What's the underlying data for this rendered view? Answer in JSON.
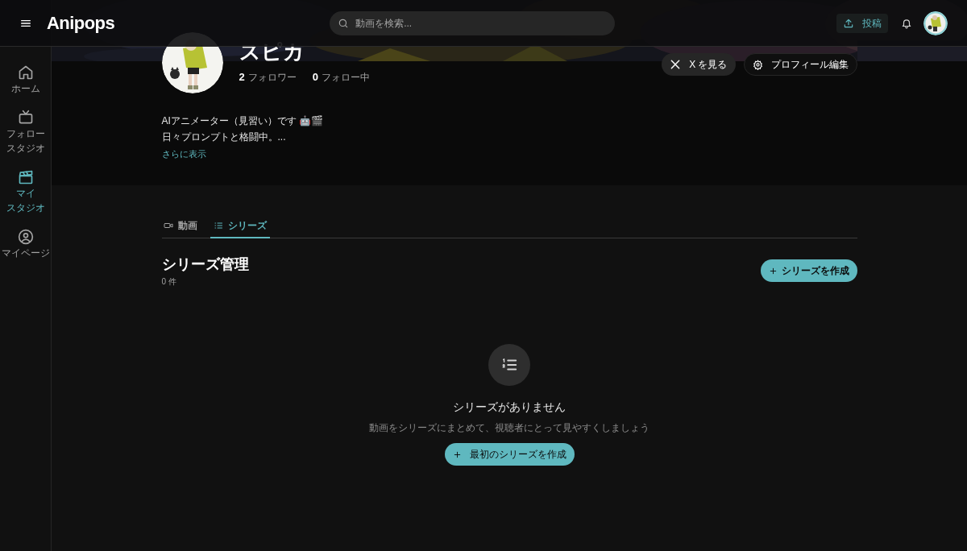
{
  "header": {
    "logo": "Anipops",
    "search": {
      "placeholder": "動画を検索..."
    },
    "upload_button": "投稿"
  },
  "sidebar": {
    "items": [
      {
        "lines": [
          "ホーム"
        ],
        "selected": false
      },
      {
        "lines": [
          "フォロー",
          "スタジオ"
        ],
        "selected": false
      },
      {
        "lines": [
          "マイ",
          "スタジオ"
        ],
        "selected": true
      },
      {
        "lines": [
          "マイページ"
        ],
        "selected": false
      }
    ]
  },
  "profile": {
    "name": "スピカ",
    "followers": {
      "count": "2",
      "label": "フォロワー"
    },
    "following": {
      "count": "0",
      "label": "フォロー中"
    },
    "buttons": [
      {
        "kind": "x",
        "label": "X を見る"
      },
      {
        "kind": "edit",
        "label": "プロフィール編集"
      }
    ],
    "bio": [
      "AIアニメーター（見習い）です 🤖🎬",
      "日々プロンプトと格闘中。..."
    ],
    "more_link": "さらに表示"
  },
  "tabs": [
    {
      "label": "動画",
      "selected": false
    },
    {
      "label": "シリーズ",
      "selected": true
    }
  ],
  "section": {
    "title": "シリーズ管理",
    "count": "0 件",
    "create_button": "シリーズを作成"
  },
  "empty_state": {
    "title": "シリーズがありません",
    "message": "動画をシリーズにまとめて、視聴者にとって見やすくしましょう",
    "button": "最初のシリーズを作成"
  }
}
